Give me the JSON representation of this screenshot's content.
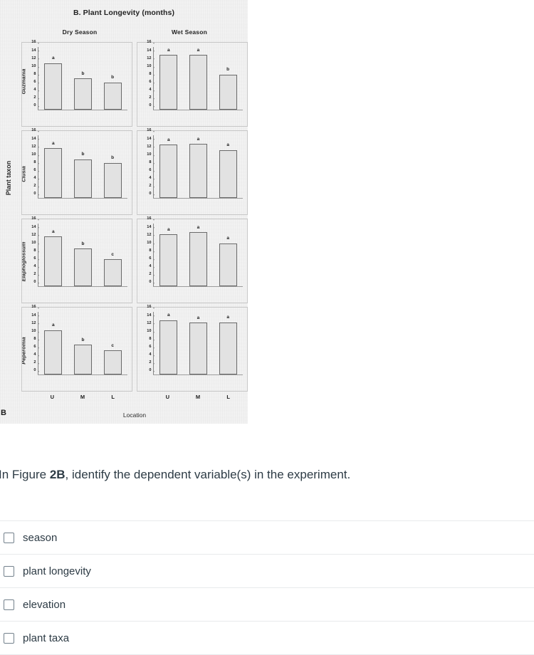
{
  "figure": {
    "title": "B.  Plant Longevity (months)",
    "panel_letter": "B",
    "season_headers": [
      "Dry Season",
      "Wet Season"
    ],
    "y_outer_label": "Plant taxon",
    "x_label": "Location",
    "taxa": [
      "Guzmania",
      "Clusia",
      "Elaphoglossum",
      "Peperomia"
    ],
    "x_categories": [
      "U",
      "M",
      "L"
    ],
    "y_ticks": [
      "16",
      "14",
      "12",
      "10",
      "8",
      "6",
      "4",
      "2",
      "0"
    ]
  },
  "chart_data": {
    "type": "bar",
    "title": "B.  Plant Longevity (months)",
    "xlabel": "Location",
    "ylabel": "Plant taxon",
    "ylim": [
      0,
      16
    ],
    "grid": false,
    "legend": "none",
    "categories": [
      "U",
      "M",
      "L"
    ],
    "panels": [
      {
        "row": "Guzmania",
        "column": "Dry Season",
        "values": [
          11.9,
          8.0,
          7.0
        ],
        "annotations": [
          "a",
          "b",
          "b"
        ]
      },
      {
        "row": "Guzmania",
        "column": "Wet Season",
        "values": [
          14.0,
          14.0,
          9.0
        ],
        "annotations": [
          "a",
          "a",
          "b"
        ]
      },
      {
        "row": "Clusia",
        "column": "Dry Season",
        "values": [
          12.7,
          9.9,
          9.0
        ],
        "annotations": [
          "a",
          "b",
          "b"
        ]
      },
      {
        "row": "Clusia",
        "column": "Wet Season",
        "values": [
          13.6,
          13.8,
          12.2
        ],
        "annotations": [
          "a",
          "a",
          "a"
        ]
      },
      {
        "row": "Elaphoglossum",
        "column": "Dry Season",
        "values": [
          12.7,
          9.6,
          6.9
        ],
        "annotations": [
          "a",
          "b",
          "c"
        ]
      },
      {
        "row": "Elaphoglossum",
        "column": "Wet Season",
        "values": [
          13.2,
          13.8,
          11.0
        ],
        "annotations": [
          "a",
          "a",
          "a"
        ]
      },
      {
        "row": "Peperomia",
        "column": "Dry Season",
        "values": [
          11.3,
          7.6,
          6.1
        ],
        "annotations": [
          "a",
          "b",
          "c"
        ]
      },
      {
        "row": "Peperomia",
        "column": "Wet Season",
        "values": [
          13.9,
          13.2,
          13.3
        ],
        "annotations": [
          "a",
          "a",
          "a"
        ]
      }
    ]
  },
  "question": {
    "text_before": "In Figure ",
    "emphasis": "2B",
    "text_after": ", identify the dependent variable(s) in the experiment."
  },
  "answers": [
    {
      "label": "season",
      "checked": false
    },
    {
      "label": "plant longevity",
      "checked": false
    },
    {
      "label": "elevation",
      "checked": false
    },
    {
      "label": "plant taxa",
      "checked": false
    }
  ],
  "colors": {
    "figure_background": "#f4f4f4",
    "bar_fill": "#e2e2e2",
    "bar_border": "#6a6a6a",
    "text": "#2d3b45",
    "divider": "#e8eaec"
  }
}
